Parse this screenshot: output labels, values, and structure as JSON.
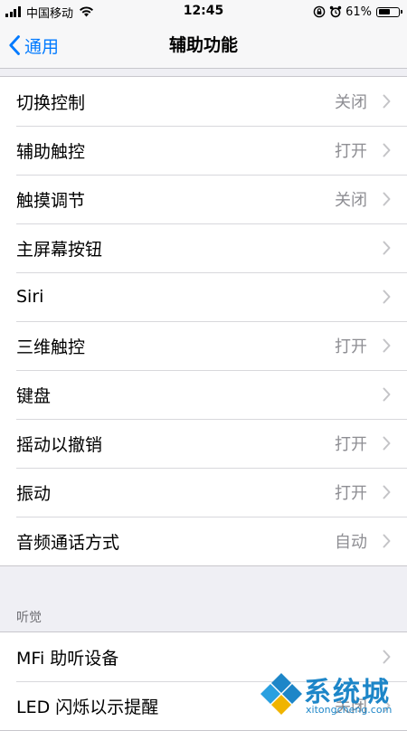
{
  "status_bar": {
    "carrier": "中国移动",
    "time": "12:45",
    "battery_percent": "61%",
    "battery_level": 0.61,
    "wifi_icon": "wifi-icon",
    "lock_rotation_icon": "rotation-lock-icon",
    "alarm_icon": "alarm-icon"
  },
  "nav": {
    "back_label": "通用",
    "title": "辅助功能"
  },
  "main_group": {
    "items": [
      {
        "label": "切换控制",
        "value": "关闭"
      },
      {
        "label": "辅助触控",
        "value": "打开"
      },
      {
        "label": "触摸调节",
        "value": "关闭"
      },
      {
        "label": "主屏幕按钮",
        "value": ""
      },
      {
        "label": "Siri",
        "value": ""
      },
      {
        "label": "三维触控",
        "value": "打开"
      },
      {
        "label": "键盘",
        "value": ""
      },
      {
        "label": "摇动以撤销",
        "value": "打开"
      },
      {
        "label": "振动",
        "value": "打开"
      },
      {
        "label": "音频通话方式",
        "value": "自动"
      }
    ]
  },
  "hearing_group": {
    "header": "听觉",
    "items": [
      {
        "label": "MFi 助听设备",
        "value": ""
      },
      {
        "label": "LED 闪烁以示提醒",
        "value": "关闭"
      }
    ]
  },
  "watermark": {
    "brand": "系统城",
    "url": "xitongcheng.com"
  },
  "colors": {
    "accent": "#007aff",
    "background": "#efeff4",
    "secondary_text": "#8e8e93",
    "watermark": "#1d86c8"
  }
}
